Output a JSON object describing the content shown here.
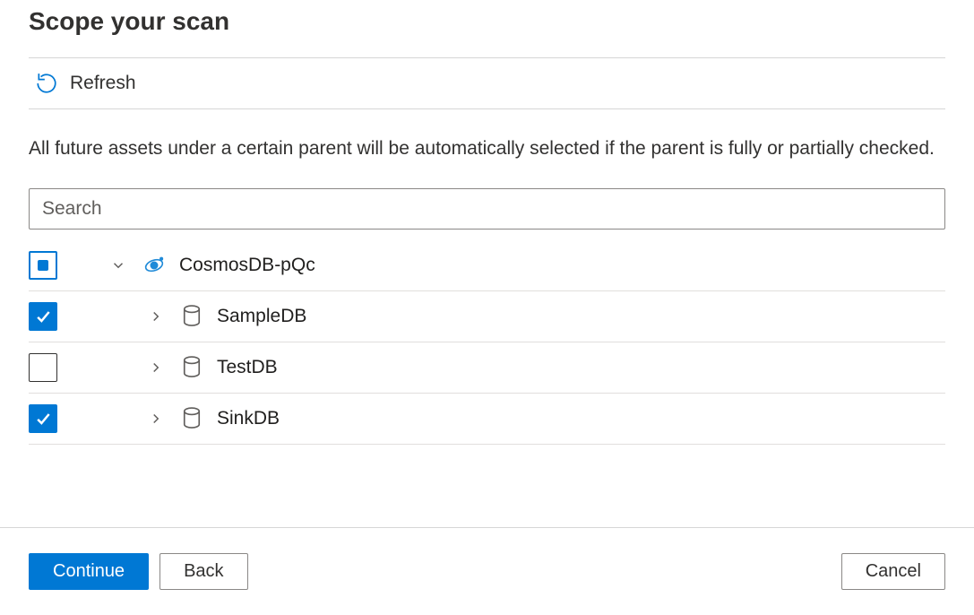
{
  "title": "Scope your scan",
  "refresh_label": "Refresh",
  "help_text": "All future assets under a certain parent will be automatically selected if the parent is fully or partially checked.",
  "search": {
    "placeholder": "Search",
    "value": ""
  },
  "tree": {
    "root": {
      "label": "CosmosDB-pQc",
      "state": "indeterminate",
      "expanded": true,
      "icon": "cosmosdb-icon"
    },
    "children": [
      {
        "label": "SampleDB",
        "state": "checked",
        "expanded": false,
        "icon": "database-icon"
      },
      {
        "label": "TestDB",
        "state": "unchecked",
        "expanded": false,
        "icon": "database-icon"
      },
      {
        "label": "SinkDB",
        "state": "checked",
        "expanded": false,
        "icon": "database-icon"
      }
    ]
  },
  "buttons": {
    "continue": "Continue",
    "back": "Back",
    "cancel": "Cancel"
  }
}
